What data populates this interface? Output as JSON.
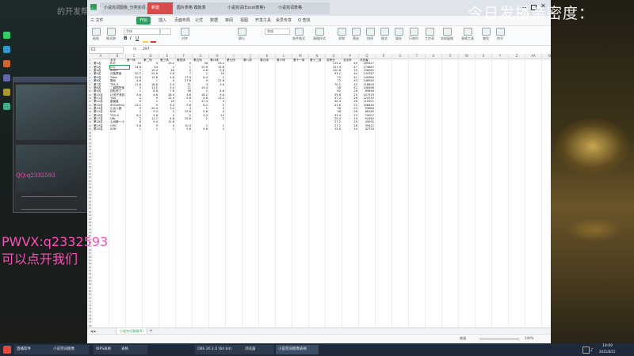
{
  "overlays": {
    "top_right": "今日发播亲密度：",
    "left_id": "PWVX:q2332593",
    "left_note": "可以点开我们",
    "top_left_faint": "的开发帮你了",
    "left_mid_small": "QQ:q2332593"
  },
  "window_tabs": [
    "小说完词图像_分类完词...",
    "新建",
    "图片表格 模板表",
    "小说完词(Excel表格)",
    "小说完词表格"
  ],
  "menu": [
    "三 文件",
    "开始",
    "插入",
    "页面布局",
    "公式",
    "数据",
    "审阅",
    "视图",
    "开发工具",
    "会员专享",
    "Q 查找"
  ],
  "ribbon": [
    "粘贴",
    "格式刷",
    "字体",
    "对齐",
    "换行",
    "常规",
    "条件格式",
    "表格样式",
    "求和",
    "筛选",
    "排序",
    "格式",
    "填充",
    "行和列",
    "工作表",
    "冻结窗格",
    "表格工具",
    "查找",
    "符号"
  ],
  "formula_bar": {
    "cell_ref": "E2",
    "fx": "fx",
    "value": "297"
  },
  "columns": [
    "A",
    "B",
    "C",
    "D",
    "E",
    "F",
    "G",
    "H",
    "I",
    "J",
    "K",
    "L",
    "M",
    "N",
    "O",
    "P",
    "Q",
    "R",
    "S",
    "T",
    "U",
    "V",
    "W",
    "X",
    "Y",
    "Z",
    "AA",
    "AB",
    "AC",
    "AD"
  ],
  "header_row": [
    "",
    "名字",
    "第一场",
    "第二场",
    "第三场",
    "第四场",
    "第五场",
    "第六场",
    "第七场",
    "第八场",
    "第九场",
    "第十场",
    "第十一场",
    "第十二场",
    "总积分",
    "总击杀",
    "总伤害"
  ],
  "rows": [
    [
      "第1名",
      "ROF",
      "30",
      "5",
      "23.2",
      "0",
      "38",
      "23.2",
      "",
      "",
      "",
      "",
      "",
      "",
      "115.2",
      "49",
      "169427"
    ],
    [
      "第2名",
      "IOS",
      "14.8",
      "44",
      "2",
      "1",
      "20.8",
      "15.8",
      "",
      "",
      "",
      "",
      "",
      "",
      "101.4",
      "47",
      "174867"
    ],
    [
      "第3名",
      "BARA",
      "7",
      "15.4",
      "48",
      "0",
      "4.6",
      "5.8",
      "",
      "",
      "",
      "",
      "",
      "",
      "100.8",
      "55",
      "156062"
    ],
    [
      "第4名",
      "月能乘客",
      "20.2",
      "25.6",
      "3.6",
      "7",
      "1",
      "35",
      "",
      "",
      "",
      "",
      "",
      "",
      "93.2",
      "45",
      "134787"
    ],
    [
      "第5名",
      "Tribe",
      "20.8",
      "15.8",
      "5.8",
      "17.4",
      "6.4",
      "2",
      "",
      "",
      "",
      "",
      "",
      "",
      "72",
      "41",
      "140984"
    ],
    [
      "第6名",
      "霸世",
      "4.6",
      "1",
      "0",
      "27.8",
      "9",
      "21.8",
      "",
      "",
      "",
      "",
      "",
      "",
      "72",
      "43",
      "146940"
    ],
    [
      "第7名",
      "TBS-A",
      "11.8",
      "18.8",
      "3.4",
      "31",
      "3",
      "3.6",
      "",
      "",
      "",
      "",
      "",
      "",
      "70.2",
      "42",
      "118894"
    ],
    [
      "第8名",
      "二级刚折驱",
      "5",
      "13.2",
      "3.4",
      "21",
      "15.4",
      "",
      "",
      "",
      "",
      "",
      "",
      "",
      "58",
      "41",
      "146468"
    ],
    [
      "第9名",
      "战队死了",
      "1",
      "8.8",
      "7.6",
      "38",
      "2",
      "4.6",
      "",
      "",
      "",
      "",
      "",
      "",
      "62",
      "28",
      "89846"
    ],
    [
      "第10名",
      "LF电子竞技",
      "4.6",
      "4.6",
      "18.4",
      "4.6",
      "18.2",
      "9.4",
      "",
      "",
      "",
      "",
      "",
      "",
      "59.8",
      "25",
      "107519"
    ],
    [
      "第11名",
      "YRA",
      "2",
      "9",
      "12.4",
      "5.8",
      "4.6",
      "13.2",
      "",
      "",
      "",
      "",
      "",
      "",
      "47.2",
      "26",
      "124745"
    ],
    [
      "第12名",
      "童星星",
      "0",
      "1",
      "19",
      "1",
      "17.4",
      "3",
      "",
      "",
      "",
      "",
      "",
      "",
      "44.4",
      "26",
      "110401"
    ],
    [
      "第13名",
      "XOGaming",
      "13.2",
      "9",
      "3.4",
      "5.8",
      "8.2",
      "2",
      "",
      "",
      "",
      "",
      "",
      "",
      "41.6",
      "22",
      "106445"
    ],
    [
      "第14名",
      "小女人团",
      "9",
      "20.4",
      "3.4",
      "4",
      "1",
      "0",
      "",
      "",
      "",
      "",
      "",
      "",
      "38",
      "23",
      "93880"
    ],
    [
      "第15名",
      "KOK",
      "1",
      "9.4",
      "2",
      "15.8",
      "5.8",
      "4",
      "",
      "",
      "",
      "",
      "",
      "",
      "38",
      "26",
      "88165"
    ],
    [
      "第16名",
      "TSG-X",
      "6.2",
      "5.6",
      "0",
      "2",
      "3.4",
      "13",
      "",
      "",
      "",
      "",
      "",
      "",
      "33.4",
      "23",
      "79007"
    ],
    [
      "第17名",
      "UBL",
      "2",
      "11.2",
      "4.6",
      "15.8",
      "2",
      "2",
      "",
      "",
      "",
      "",
      "",
      "",
      "29.4",
      "19",
      "92462"
    ],
    [
      "第18名",
      "心动拳一小",
      "6",
      "9.4",
      "11.8",
      "",
      "",
      "",
      "",
      "",
      "",
      "",
      "",
      "",
      "27.2",
      "20",
      "43092"
    ],
    [
      "第19名",
      "CMC",
      "5.8",
      "9",
      "0",
      "10.4",
      "1",
      "1",
      "",
      "",
      "",
      "",
      "",
      "",
      "27.2",
      "16",
      "59421"
    ],
    [
      "第20名",
      "XZN",
      "1",
      "1",
      "1",
      "5.8",
      "4.6",
      "2",
      "",
      "",
      "",
      "",
      "",
      "",
      "15.4",
      "10",
      "42754"
    ]
  ],
  "sheet_tabs": [
    "小说完词表格(R)",
    "+"
  ],
  "status": {
    "zoom": "100%",
    "mode": "普通"
  },
  "taskbar_items": [
    "直播软件",
    "小说完词图像",
    "WPS表格",
    "表格",
    "OBS 26.1.0 (64 bit)",
    "浏览器",
    "小说完词图像表格"
  ],
  "tray": {
    "time": "19:09",
    "date": "2021/8/15"
  },
  "colors": {
    "accent": "#2d9b5d",
    "overlay_white": "#ffffff",
    "overlay_pink": "#ff4fb8",
    "taskbar": "#1e2a3a"
  }
}
